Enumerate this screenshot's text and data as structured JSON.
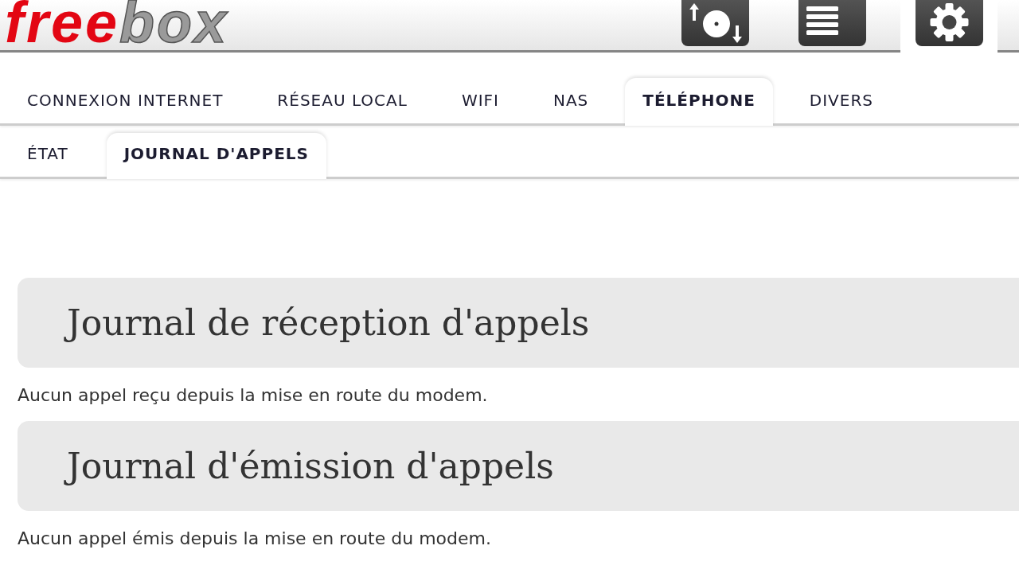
{
  "header": {
    "logo": [
      {
        "text": "free",
        "color": "#e30613"
      },
      {
        "text": "box",
        "color": "#9a9a9a"
      }
    ],
    "toolbar": [
      {
        "kind": "transfers",
        "selected": false
      },
      {
        "kind": "logs",
        "selected": false
      },
      {
        "kind": "settings",
        "selected": true
      }
    ]
  },
  "tabs": [
    {
      "label": "CONNEXION INTERNET",
      "selected": false
    },
    {
      "label": "RÉSEAU LOCAL",
      "selected": false
    },
    {
      "label": "WIFI",
      "selected": false
    },
    {
      "label": "NAS",
      "selected": false
    },
    {
      "label": "TÉLÉPHONE",
      "selected": true
    },
    {
      "label": "DIVERS",
      "selected": false
    }
  ],
  "subtabs": [
    {
      "label": "ÉTAT",
      "selected": false
    },
    {
      "label": "JOURNAL D'APPELS",
      "selected": true
    }
  ],
  "sections": [
    {
      "title": "Journal de réception d'appels",
      "message": "Aucun appel reçu depuis la mise en route du modem."
    },
    {
      "title": "Journal d'émission d'appels",
      "message": "Aucun appel émis depuis la mise en route du modem."
    }
  ]
}
